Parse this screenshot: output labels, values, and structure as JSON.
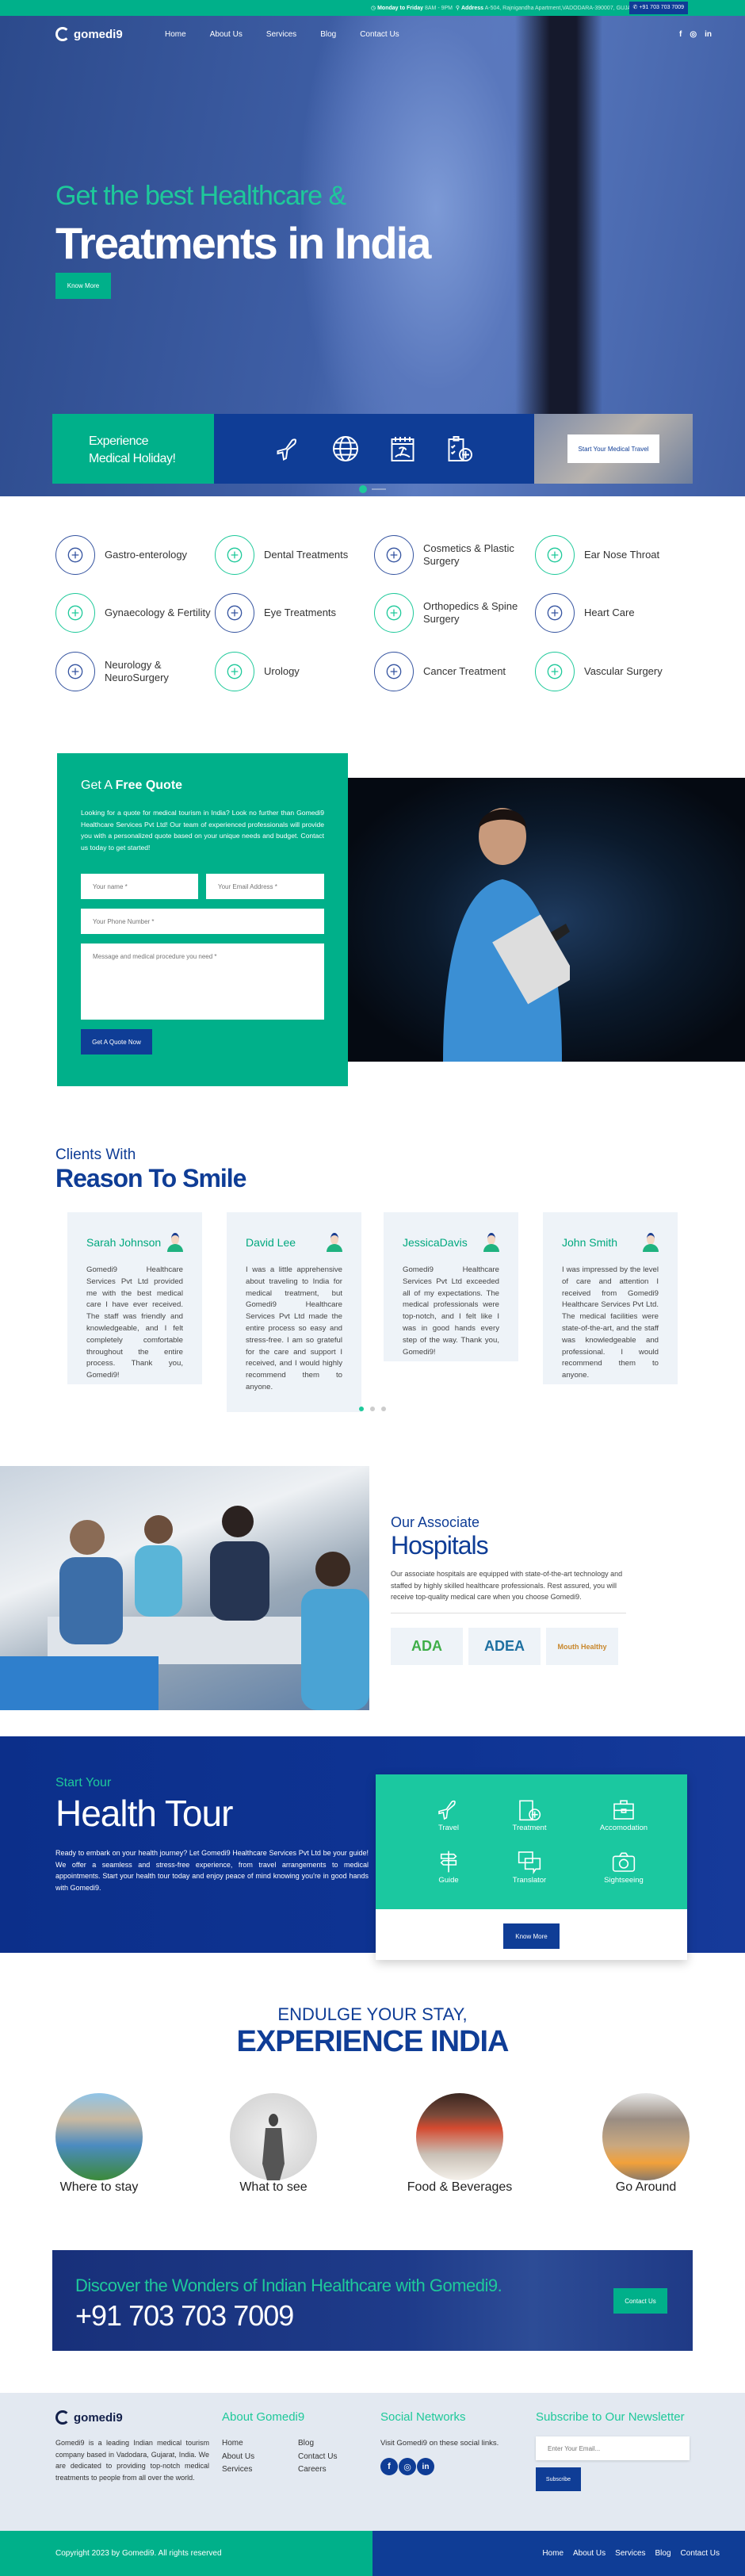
{
  "topbar": {
    "hours_label": "Monday to Friday",
    "hours_value": "8AM - 9PM",
    "address_label": "Address",
    "address_value": "A-504, Rajnigandha Apartment,VADODARA-390007, GUJARAT, India.",
    "phone": "+91 703 703 7009"
  },
  "header": {
    "logo": "gomedi9",
    "nav": [
      "Home",
      "About Us",
      "Services",
      "Blog",
      "Contact Us"
    ],
    "social": [
      "f",
      "ig",
      "in"
    ]
  },
  "hero": {
    "subtitle": "Get the best Healthcare &",
    "title": "Treatments in India",
    "button": "Know More",
    "slide_count": 2,
    "active_slide": 1
  },
  "holiday": {
    "line1": "Experience",
    "line2": "Medical Holiday!",
    "icons": [
      "airplane-icon",
      "globe-icon",
      "beach-calendar-icon",
      "medical-checklist-icon"
    ],
    "button": "Start Your Medical Travel"
  },
  "services": [
    {
      "label": "Gastro-enterology",
      "icon": "stomach-icon"
    },
    {
      "label": "Dental Treatments",
      "icon": "tooth-icon"
    },
    {
      "label": "Cosmetics & Plastic Surgery",
      "icon": "face-icon"
    },
    {
      "label": "Ear Nose Throat",
      "icon": "ent-icon"
    },
    {
      "label": "Gynaecology & Fertility",
      "icon": "pregnancy-icon"
    },
    {
      "label": "Eye Treatments",
      "icon": "eye-icon"
    },
    {
      "label": "Orthopedics & Spine Surgery",
      "icon": "spine-icon"
    },
    {
      "label": "Heart Care",
      "icon": "heart-icon"
    },
    {
      "label": "Neurology & NeuroSurgery",
      "icon": "brain-icon"
    },
    {
      "label": "Urology",
      "icon": "kidney-icon"
    },
    {
      "label": "Cancer Treatment",
      "icon": "ribbon-icon"
    },
    {
      "label": "Vascular Surgery",
      "icon": "vascular-icon"
    }
  ],
  "quote": {
    "title_pre": "Get A",
    "title_bold": "Free Quote",
    "text": "Looking for a quote for medical tourism in India? Look no further than Gomedi9 Healthcare Services Pvt Ltd! Our team of experienced professionals will provide you with a personalized quote based on your unique needs and budget. Contact us today to get started!",
    "name_placeholder": "Your name *",
    "email_placeholder": "Your Email Address *",
    "phone_placeholder": "Your Phone Number *",
    "message_placeholder": "Message and medical procedure you need *",
    "button": "Get A Quote Now"
  },
  "testimonials": {
    "subtitle": "Clients With",
    "title": "Reason To Smile",
    "items": [
      {
        "name": "Sarah Johnson",
        "text": "Gomedi9 Healthcare Services Pvt Ltd provided me with the best medical care I have ever received. The staff was friendly and knowledgeable, and I felt completely comfortable throughout the entire process. Thank you, Gomedi9!"
      },
      {
        "name": "David Lee",
        "text": "I was a little apprehensive about traveling to India for medical treatment, but Gomedi9 Healthcare Services Pvt Ltd made the entire process so easy and stress-free. I am so grateful for the care and support I received, and I would highly recommend them to anyone."
      },
      {
        "name": "JessicaDavis",
        "text": "Gomedi9 Healthcare Services Pvt Ltd exceeded all of my expectations. The medical professionals were top-notch, and I felt like I was in good hands every step of the way. Thank you, Gomedi9!"
      },
      {
        "name": "John Smith",
        "text": "I was impressed by the level of care and attention I received from Gomedi9 Healthcare Services Pvt Ltd. The medical facilities were state-of-the-art, and the staff was knowledgeable and professional. I would recommend them to anyone."
      }
    ],
    "page_count": 3,
    "active_page": 1
  },
  "hospitals": {
    "subtitle": "Our Associate",
    "title": "Hospitals",
    "text": "Our associate hospitals are equipped with state-of-the-art technology and staffed by highly skilled healthcare professionals. Rest assured, you will receive top-quality medical care when you choose Gomedi9.",
    "logos": [
      "ADA",
      "ADEA",
      "Mouth Healthy"
    ],
    "logo_colors": [
      "#3fae49",
      "#1d6fa0",
      "#c8872c"
    ]
  },
  "tour": {
    "subtitle": "Start Your",
    "title": "Health Tour",
    "text": "Ready to embark on your health journey? Let Gomedi9 Healthcare Services Pvt Ltd be your guide! We offer a seamless and stress-free experience, from travel arrangements to medical appointments. Start your health tour today and enjoy peace of mind knowing you're in good hands with Gomedi9.",
    "features": [
      "Travel",
      "Treatment",
      "Accomodation",
      "Guide",
      "Translator",
      "Sightseeing"
    ],
    "button": "Know More"
  },
  "experience": {
    "subtitle": "ENDULGE YOUR STAY,",
    "title": "EXPERIENCE INDIA",
    "items": [
      "Where to stay",
      "What to see",
      "Food & Beverages",
      "Go Around"
    ]
  },
  "cta": {
    "text": "Discover the Wonders of Indian Healthcare with Gomedi9.",
    "phone": "+91 703 703 7009",
    "button": "Contact Us"
  },
  "footer": {
    "logo": "gomedi9",
    "about_text": "Gomedi9 is a leading Indian medical tourism company based in Vadodara, Gujarat, India. We are dedicated to providing top-notch medical treatments to people from all over the world.",
    "about_title": "About Gomedi9",
    "links_col1": [
      "Home",
      "About Us",
      "Services"
    ],
    "links_col2": [
      "Blog",
      "Contact Us",
      "Careers"
    ],
    "social_title": "Social Networks",
    "social_text": "Visit Gomedi9 on these social links.",
    "social": [
      "f",
      "ig",
      "in"
    ],
    "newsletter_title": "Subscribe to Our Newsletter",
    "email_placeholder": "Enter Your Email...",
    "subscribe": "Subscribe",
    "copyright": "Copyright 2023 by Gomedi9. All rights reserved",
    "bottom_nav": [
      "Home",
      "About Us",
      "Services",
      "Blog",
      "Contact Us"
    ]
  },
  "colors": {
    "green": "#00b08a",
    "teal": "#1bc8a0",
    "blue": "#0f3d96",
    "footer_bg": "#e3e9f1"
  }
}
